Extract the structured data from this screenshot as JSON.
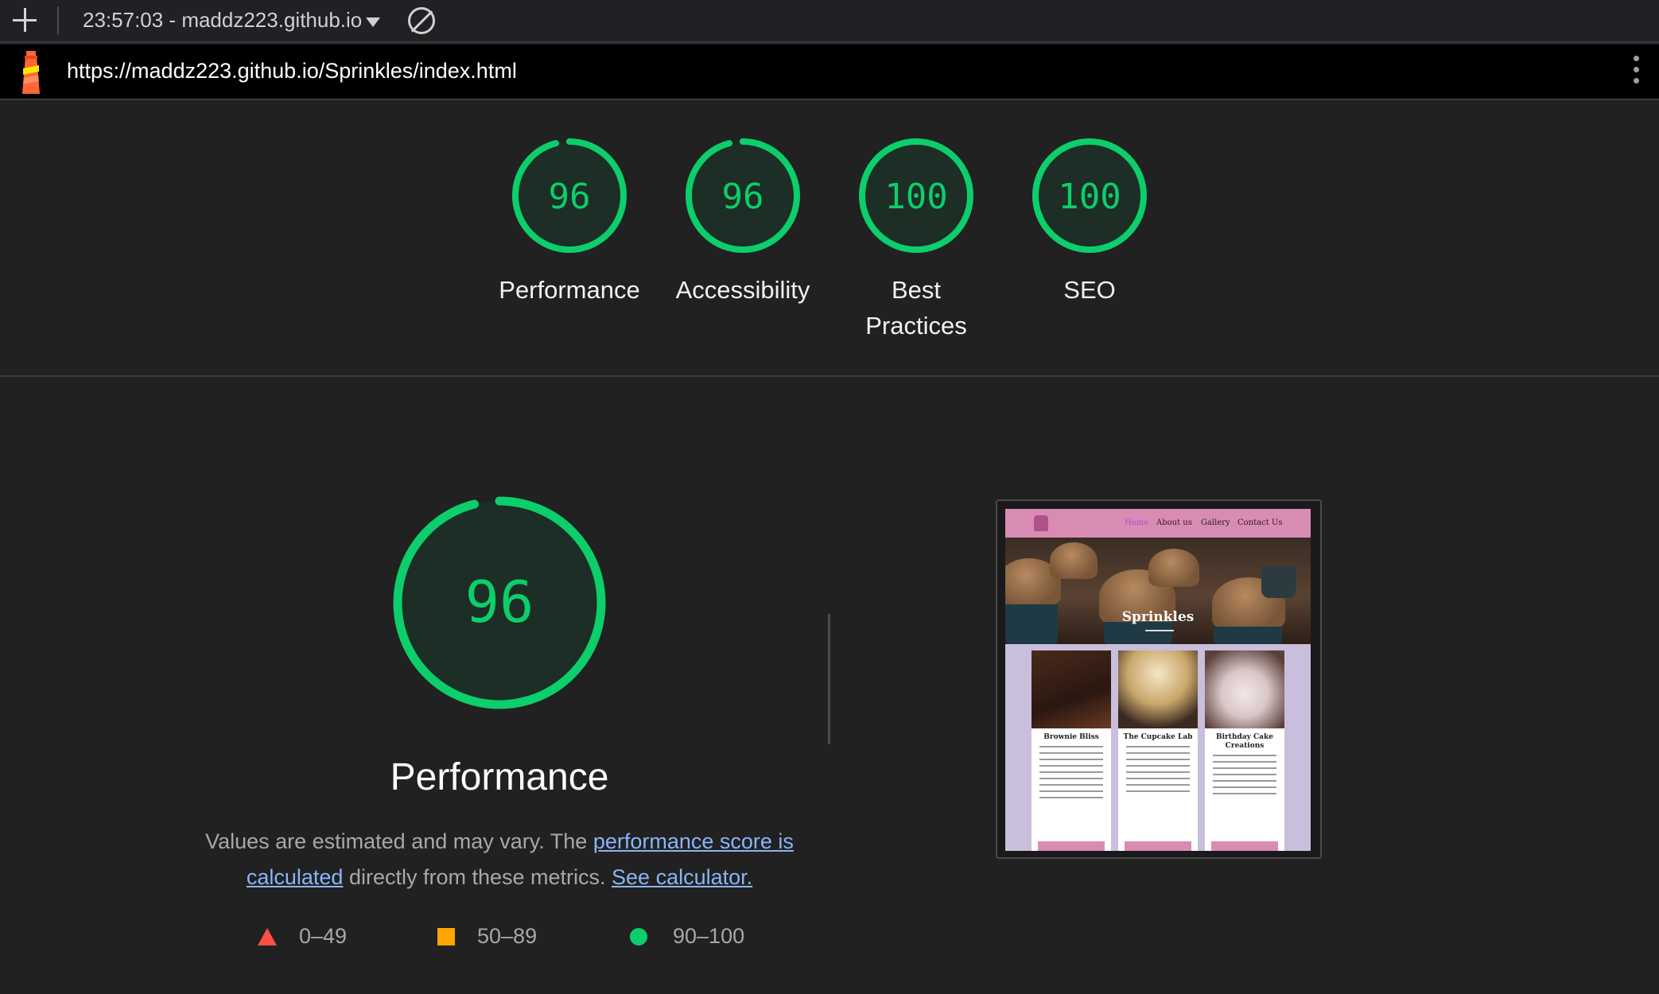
{
  "toolbar": {
    "report_label": "23:57:03 - maddz223.github.io"
  },
  "urlbar": {
    "url": "https://maddz223.github.io/Sprinkles/index.html"
  },
  "gauges": [
    {
      "score": "96",
      "label": "Performance"
    },
    {
      "score": "96",
      "label": "Accessibility"
    },
    {
      "score": "100",
      "label": "Best Practices"
    },
    {
      "score": "100",
      "label": "SEO"
    }
  ],
  "performance": {
    "score": "96",
    "title": "Performance",
    "desc_prefix": "Values are estimated and may vary. The ",
    "desc_link1": "performance score is calculated",
    "desc_middle": " directly from these metrics. ",
    "desc_link2": "See calculator."
  },
  "legend": {
    "fail": "0–49",
    "average": "50–89",
    "pass": "90–100"
  },
  "thumbnail": {
    "nav": [
      "Home",
      "About us",
      "Gallery",
      "Contact Us"
    ],
    "hero_title": "Sprinkles",
    "cards": [
      {
        "title": "Brownie Bliss"
      },
      {
        "title": "The Cupcake Lab"
      },
      {
        "title": "Birthday Cake Creations"
      }
    ]
  },
  "colors": {
    "pass": "#0cce6b",
    "average": "#ffa400",
    "fail": "#ff4e42",
    "link": "#8ab4f8",
    "background": "#212121"
  }
}
